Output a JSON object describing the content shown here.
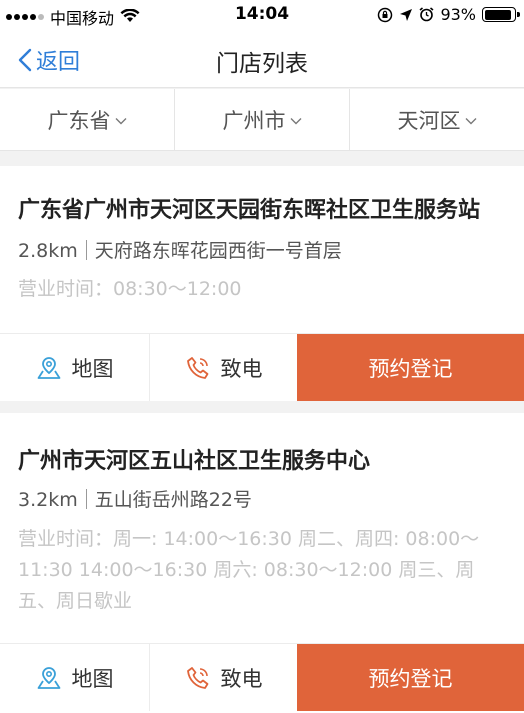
{
  "status_bar": {
    "carrier": "中国移动",
    "time": "14:04",
    "battery": "93%"
  },
  "nav": {
    "back_label": "返回",
    "title": "门店列表"
  },
  "filters": [
    {
      "label": "广东省"
    },
    {
      "label": "广州市"
    },
    {
      "label": "天河区"
    }
  ],
  "stores": [
    {
      "name": "广东省广州市天河区天园街东晖社区卫生服务站",
      "distance": "2.8km",
      "address": "天府路东晖花园西街一号首层",
      "hours": "营业时间：08:30～12:00"
    },
    {
      "name": "广州市天河区五山社区卫生服务中心",
      "distance": "3.2km",
      "address": "五山街岳州路22号",
      "hours": "营业时间：周一: 14:00～16:30 周二、周四: 08:00～11:30 14:00～16:30 周六: 08:30～12:00 周三、周五、周日歇业"
    }
  ],
  "actions": {
    "map_label": "地图",
    "call_label": "致电",
    "book_label": "预约登记"
  },
  "colors": {
    "accent_blue": "#2f7ed8",
    "book_orange": "#e0643a",
    "map_icon": "#3aa0d8",
    "call_icon": "#e0643a"
  }
}
